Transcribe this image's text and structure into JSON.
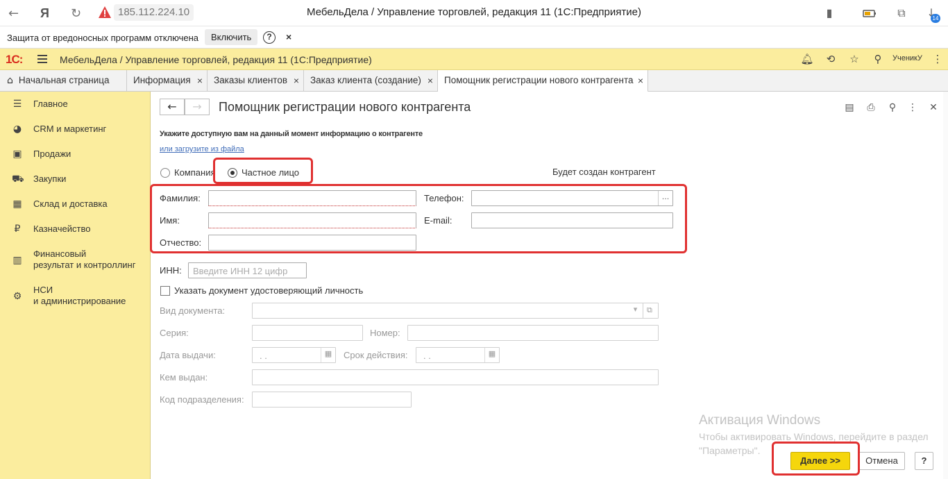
{
  "browser": {
    "address": "185.112.224.10",
    "window_title": "МебельДела / Управление торговлей, редакция 11 (1С:Предприятие)",
    "download_badge": "14",
    "icons": [
      "back-arrow-icon",
      "yandex-icon",
      "reload-icon",
      "warning-icon",
      "bookmark-icon",
      "battery-icon",
      "extensions-icon",
      "download-icon"
    ]
  },
  "infobar": {
    "text": "Защита от вредоносных программ отключена",
    "enable_label": "Включить",
    "help": "?",
    "close": "×"
  },
  "app": {
    "logo": "1С:",
    "title": "МебельДела / Управление торговлей, редакция 11  (1С:Предприятие)",
    "user": "УченикУ",
    "icons": [
      "bell-icon",
      "history-icon",
      "star-icon",
      "search-icon",
      "menu-dots-icon"
    ]
  },
  "tabs": [
    {
      "label": "Начальная страница",
      "closable": false
    },
    {
      "label": "Информация",
      "closable": true
    },
    {
      "label": "Заказы клиентов",
      "closable": true
    },
    {
      "label": "Заказ клиента (создание)",
      "closable": true
    },
    {
      "label": "Помощник регистрации нового контрагента",
      "closable": true,
      "active": true
    }
  ],
  "sidebar": {
    "items": [
      {
        "label": "Главное",
        "icon": "hamburger-icon"
      },
      {
        "label": "CRM и маркетинг",
        "icon": "crm-icon"
      },
      {
        "label": "Продажи",
        "icon": "shopping-bag-icon"
      },
      {
        "label": "Закупки",
        "icon": "cart-icon"
      },
      {
        "label": "Склад и доставка",
        "icon": "warehouse-icon"
      },
      {
        "label": "Казначейство",
        "icon": "ruble-icon"
      },
      {
        "label": "Финансовый",
        "label2": "результат и контроллинг",
        "icon": "chart-icon"
      },
      {
        "label": "НСИ",
        "label2": "и администрирование",
        "icon": "gear-icon"
      }
    ]
  },
  "form": {
    "title": "Помощник регистрации нового контрагента",
    "hint": "Укажите доступную вам на данный момент информацию о контрагенте",
    "load_link": "или загрузите из файла",
    "radio_company": "Компания",
    "radio_person": "Частное лицо",
    "selected_type": "Частное лицо",
    "will_create": "Будет создан контрагент",
    "last_name_label": "Фамилия:",
    "first_name_label": "Имя:",
    "middle_name_label": "Отчество:",
    "phone_label": "Телефон:",
    "phone_button": "...",
    "email_label": "E-mail:",
    "inn_label": "ИНН:",
    "inn_placeholder": "Введите ИНН 12 цифр",
    "id_doc_checkbox": "Указать документ удостоверяющий личность",
    "doc_type_label": "Вид документа:",
    "series_label": "Серия:",
    "number_label": "Номер:",
    "issue_date_label": "Дата выдачи:",
    "issue_date_value": " .  .",
    "expiry_label": "Срок действия:",
    "expiry_value": " .  .",
    "issued_by_label": "Кем выдан:",
    "dept_code_label": "Код подразделения:"
  },
  "watermark": {
    "title": "Активация Windows",
    "subtitle": "Чтобы активировать Windows, перейдите в раздел \"Параметры\"."
  },
  "buttons": {
    "next": "Далее >>",
    "cancel": "Отмена",
    "help": "?"
  },
  "colors": {
    "accent_yellow": "#fbed9e",
    "primary_button": "#f5d60c",
    "highlight_red": "#e03030",
    "link_blue": "#3f6cb8",
    "logo_red": "#d92d1e"
  }
}
